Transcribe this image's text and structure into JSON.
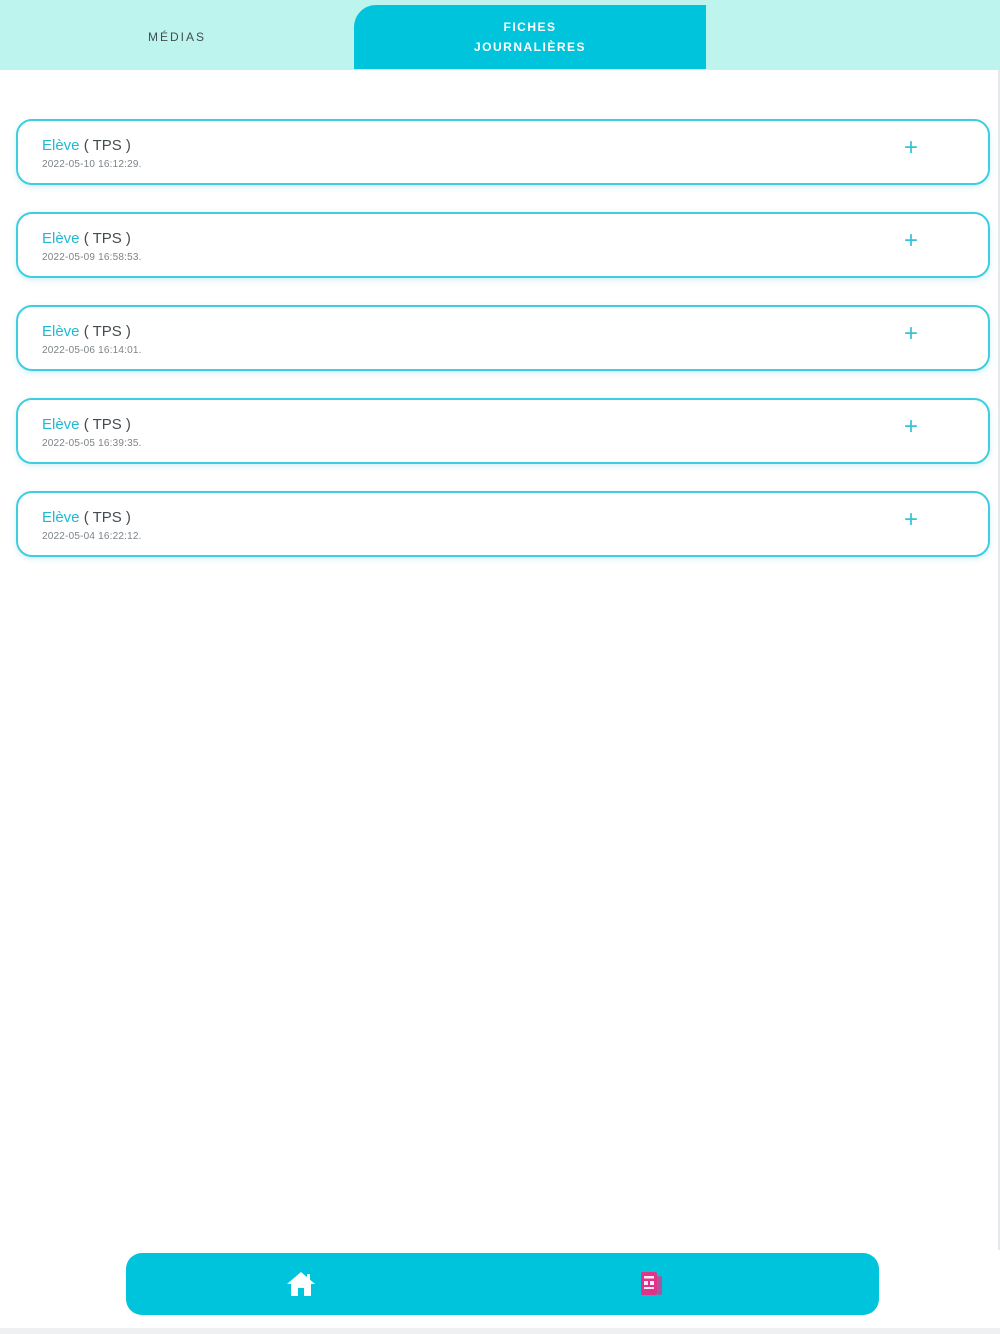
{
  "tabs": {
    "medias_label": "MÉDIAS",
    "fiches_line1": "FICHES",
    "fiches_line2": "JOURNALIÈRES"
  },
  "entries": [
    {
      "role": "Elève",
      "class": " ( TPS )",
      "date": "2022-05-10 16:12:29."
    },
    {
      "role": "Elève",
      "class": " ( TPS )",
      "date": "2022-05-09 16:58:53."
    },
    {
      "role": "Elève",
      "class": " ( TPS )",
      "date": "2022-05-06 16:14:01."
    },
    {
      "role": "Elève",
      "class": " ( TPS )",
      "date": "2022-05-05 16:39:35."
    },
    {
      "role": "Elève",
      "class": " ( TPS )",
      "date": "2022-05-04 16:22:12."
    }
  ],
  "icons": {
    "expand": "plus-icon",
    "home": "home-icon",
    "fiches": "document-icon"
  },
  "colors": {
    "accent": "#00c4dc",
    "tabbar_bg": "#bdf5ee",
    "fiches_icon": "#e0338a"
  }
}
